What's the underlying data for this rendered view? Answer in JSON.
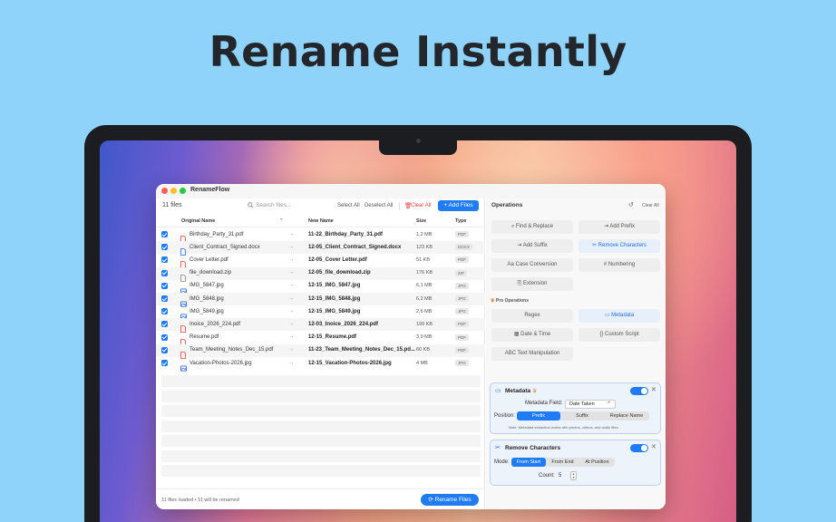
{
  "headline": "Rename Instantly",
  "window": {
    "title": "RenameFlow"
  },
  "toolbar": {
    "file_count": "11 files",
    "search_placeholder": "Search files...",
    "select_all": "Select All",
    "deselect_all": "Deselect All",
    "clear_all": "Clear All",
    "add_files": "Add Files"
  },
  "table": {
    "headers": {
      "original": "Original Name",
      "new": "New Name",
      "size": "Size",
      "type": "Type"
    },
    "rows": [
      {
        "original": "Birthday_Party_31.pdf",
        "new": "11-22_Birthday_Party_31.pdf",
        "size": "1,2 MB",
        "type": "PDF",
        "icon": "pdf-icon"
      },
      {
        "original": "Client_Contract_Signed.docx",
        "new": "12-05_Client_Contract_Signed.docx",
        "size": "123 KB",
        "type": "DOCX",
        "icon": "doc-icon"
      },
      {
        "original": "Cover Letter.pdf",
        "new": "12-05_Cover Letter.pdf",
        "size": "51 KB",
        "type": "PDF",
        "icon": "pdf-icon"
      },
      {
        "original": "file_download.zip",
        "new": "12-05_file_download.zip",
        "size": "176 KB",
        "type": "ZIP",
        "icon": "zip-icon"
      },
      {
        "original": "IMG_5847.jpg",
        "new": "12-15_IMG_5847.jpg",
        "size": "6,1 MB",
        "type": "JPG",
        "icon": "image-icon"
      },
      {
        "original": "IMG_5848.jpg",
        "new": "12-15_IMG_5848.jpg",
        "size": "6,2 MB",
        "type": "JPG",
        "icon": "image-icon"
      },
      {
        "original": "IMG_5849.jpg",
        "new": "12-15_IMG_5849.jpg",
        "size": "2,6 MB",
        "type": "JPG",
        "icon": "image-icon"
      },
      {
        "original": "Inoice_2026_224.pdf",
        "new": "12-03_Inoice_2026_224.pdf",
        "size": "199 KB",
        "type": "PDF",
        "icon": "pdf-icon"
      },
      {
        "original": "Resume.pdf",
        "new": "12-15_Resume.pdf",
        "size": "3,9 MB",
        "type": "PDF",
        "icon": "pdf-icon"
      },
      {
        "original": "Team_Meeting_Notes_Dec_15.pdf",
        "new": "11-23_Team_Meeting_Notes_Dec_15.pd...",
        "size": "60 KB",
        "type": "PDF",
        "icon": "pdf-icon"
      },
      {
        "original": "Vacation-Photos-2026.jpg",
        "new": "12-15_Vacation-Photos-2026.jpg",
        "size": "4 MB",
        "type": "JPG",
        "icon": "image-icon"
      }
    ]
  },
  "footer": {
    "status": "11 files loaded • 11 will be renamed",
    "rename_button": "Rename Files"
  },
  "operations": {
    "title": "Operations",
    "clear_all": "Clear All",
    "buttons": [
      {
        "label": "Find & Replace",
        "icon": "search-icon",
        "active": false
      },
      {
        "label": "Add Prefix",
        "icon": "arrow-icon",
        "active": false
      },
      {
        "label": "Add Suffix",
        "icon": "arrow-icon",
        "active": false
      },
      {
        "label": "Remove Characters",
        "icon": "scissors-icon",
        "active": true
      },
      {
        "label": "Case Conversion",
        "icon": "case-icon",
        "active": false
      },
      {
        "label": "Numbering",
        "icon": "hash-icon",
        "active": false
      },
      {
        "label": "Extension",
        "icon": "extension-icon",
        "active": false
      }
    ],
    "pro_label": "Pro Operations",
    "pro_buttons": [
      {
        "label": "Regex",
        "icon": "code-icon",
        "active": false
      },
      {
        "label": "Metadata",
        "icon": "metadata-icon",
        "active": true
      },
      {
        "label": "Date & Time",
        "icon": "calendar-icon",
        "active": false
      },
      {
        "label": "Custom Script",
        "icon": "braces-icon",
        "active": false
      },
      {
        "label": "Text Manipulation",
        "icon": "abc-icon",
        "active": false
      }
    ]
  },
  "metadata_card": {
    "title": "Metadata",
    "field_label": "Metadata Field:",
    "field_value": "Date Taken",
    "position_label": "Position:",
    "positions": [
      "Prefix",
      "Suffix",
      "Replace Name"
    ],
    "selected_position": "Prefix",
    "note": "Note: Metadata extraction works with photos, videos, and audio files."
  },
  "remove_card": {
    "title": "Remove Characters",
    "mode_label": "Mode:",
    "modes": [
      "From Start",
      "From End",
      "At Position"
    ],
    "selected_mode": "From Start",
    "count_label": "Count:",
    "count_value": "5"
  }
}
